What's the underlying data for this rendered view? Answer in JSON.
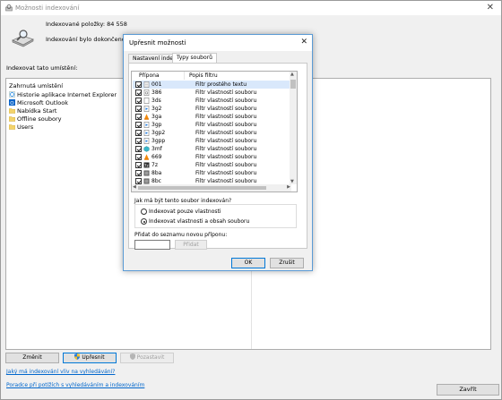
{
  "main_window": {
    "title": "Možnosti indexování",
    "indexed_count": "Indexované položky: 84 558",
    "status": "Indexování bylo dokončeno.",
    "locations_heading": "Indexovat tato umístění:",
    "included_column": "Zahrnutá umístění",
    "locations": [
      {
        "label": "Historie aplikace Internet Explorer",
        "icon": "ie-history-icon",
        "indent": false
      },
      {
        "label": "Microsoft Outlook",
        "icon": "outlook-icon",
        "indent": false
      },
      {
        "label": "Nabídka Start",
        "icon": "folder-icon",
        "indent": true
      },
      {
        "label": "Offline soubory",
        "icon": "folder-icon",
        "indent": true
      },
      {
        "label": "Users",
        "icon": "folder-icon",
        "indent": true
      }
    ],
    "buttons": {
      "modify": "Změnit",
      "advanced": "Upřesnit",
      "pause": "Pozastavit",
      "close": "Zavřít"
    },
    "links": {
      "how_indexing": "Jaký má indexování vliv na vyhledávání?",
      "troubleshoot": "Poradce při potížích s vyhledáváním a indexováním"
    },
    "colors": {
      "link": "#0066cc",
      "accent": "#0078d7"
    }
  },
  "dialog": {
    "title": "Upřesnit možnosti",
    "tabs": [
      "Nastavení indexu",
      "Typy souborů"
    ],
    "active_tab": "Typy souborů",
    "list_headers": {
      "extension": "Přípona",
      "filter": "Popis filtru"
    },
    "file_types": [
      {
        "ext": "001",
        "filter": "Filtr prostého textu",
        "icon": "text-file-icon",
        "selected": true
      },
      {
        "ext": "386",
        "filter": "Filtr vlastností souboru",
        "icon": "system-file-icon"
      },
      {
        "ext": "3ds",
        "filter": "Filtr vlastností souboru",
        "icon": "blank-file-icon"
      },
      {
        "ext": "3g2",
        "filter": "Filtr vlastností souboru",
        "icon": "media-file-icon"
      },
      {
        "ext": "3ga",
        "filter": "Filtr vlastností souboru",
        "icon": "vlc-file-icon"
      },
      {
        "ext": "3gp",
        "filter": "Filtr vlastností souboru",
        "icon": "media-file-icon"
      },
      {
        "ext": "3gp2",
        "filter": "Filtr vlastností souboru",
        "icon": "media-file-icon"
      },
      {
        "ext": "3gpp",
        "filter": "Filtr vlastností souboru",
        "icon": "media-file-icon"
      },
      {
        "ext": "3mf",
        "filter": "Filtr vlastností souboru",
        "icon": "3d-file-icon"
      },
      {
        "ext": "669",
        "filter": "Filtr vlastností souboru",
        "icon": "vlc-file-icon"
      },
      {
        "ext": "7z",
        "filter": "Filtr vlastností souboru",
        "icon": "archive-file-icon"
      },
      {
        "ext": "8ba",
        "filter": "Filtr vlastností souboru",
        "icon": "image-file-icon"
      },
      {
        "ext": "8bc",
        "filter": "Filtr vlastností souboru",
        "icon": "image-file-icon"
      }
    ],
    "how_index_question": "Jak má být tento soubor indexován?",
    "radio_props_only": "Indexovat pouze vlastnosti",
    "radio_props_content": "Indexovat vlastnosti a obsah souboru",
    "radio_selected": "props_content",
    "add_extension_label": "Přidat do seznamu novou příponu:",
    "add_extension_value": "",
    "buttons": {
      "add": "Přidat",
      "ok": "OK",
      "cancel": "Zrušit"
    }
  }
}
